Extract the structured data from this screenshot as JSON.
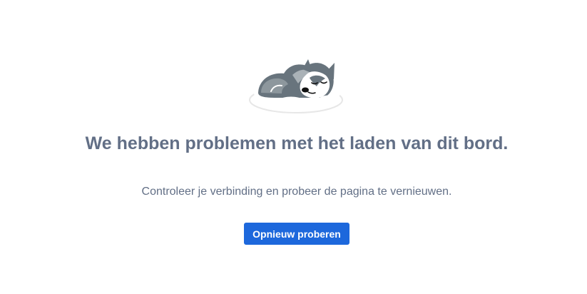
{
  "illustration": {
    "icon": "sleeping-husky-illustration"
  },
  "error": {
    "title": "We hebben problemen met het laden van dit bord.",
    "message": "Controleer je verbinding en probeer de pagina te vernieuwen.",
    "retry_label": "Opnieuw proberen"
  },
  "colors": {
    "text_muted": "#626f86",
    "button_primary": "#1d68dc",
    "button_text": "#ffffff"
  }
}
